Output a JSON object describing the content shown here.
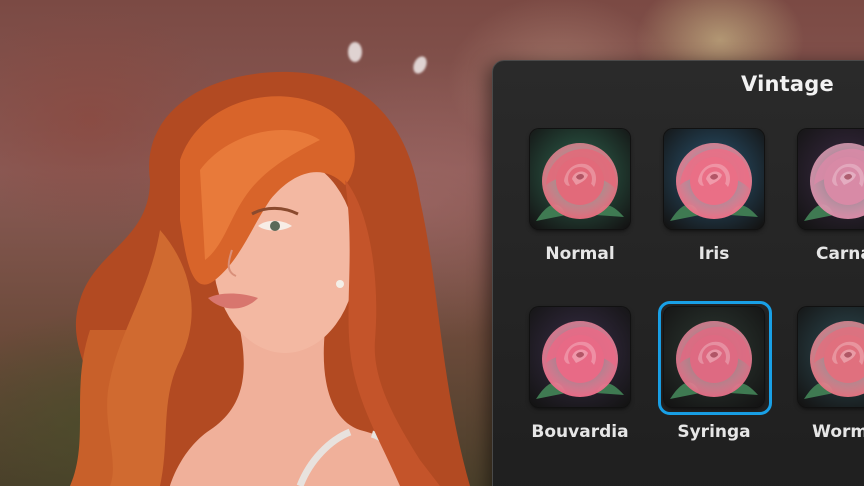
{
  "panel": {
    "title": "Vintage"
  },
  "filters": [
    {
      "label": "Normal",
      "selected": false,
      "bg": "#2f6a52",
      "petal": "#e26a7a"
    },
    {
      "label": "Iris",
      "selected": false,
      "bg": "#2a5a7a",
      "petal": "#ea6f86"
    },
    {
      "label": "Carnat",
      "selected": false,
      "bg": "#3c2a46",
      "petal": "#d88aa6"
    },
    {
      "label": "Bouvardia",
      "selected": false,
      "bg": "#3a2e4a",
      "petal": "#e86a86"
    },
    {
      "label": "Syringa",
      "selected": true,
      "bg": "#2e3b34",
      "petal": "#de6a82"
    },
    {
      "label": "Wormw",
      "selected": false,
      "bg": "#2f4f58",
      "petal": "#e0707e"
    }
  ],
  "colors": {
    "selection_accent": "#19a0e6",
    "panel_bg": "#222222",
    "label_text": "#e6e6e6"
  }
}
